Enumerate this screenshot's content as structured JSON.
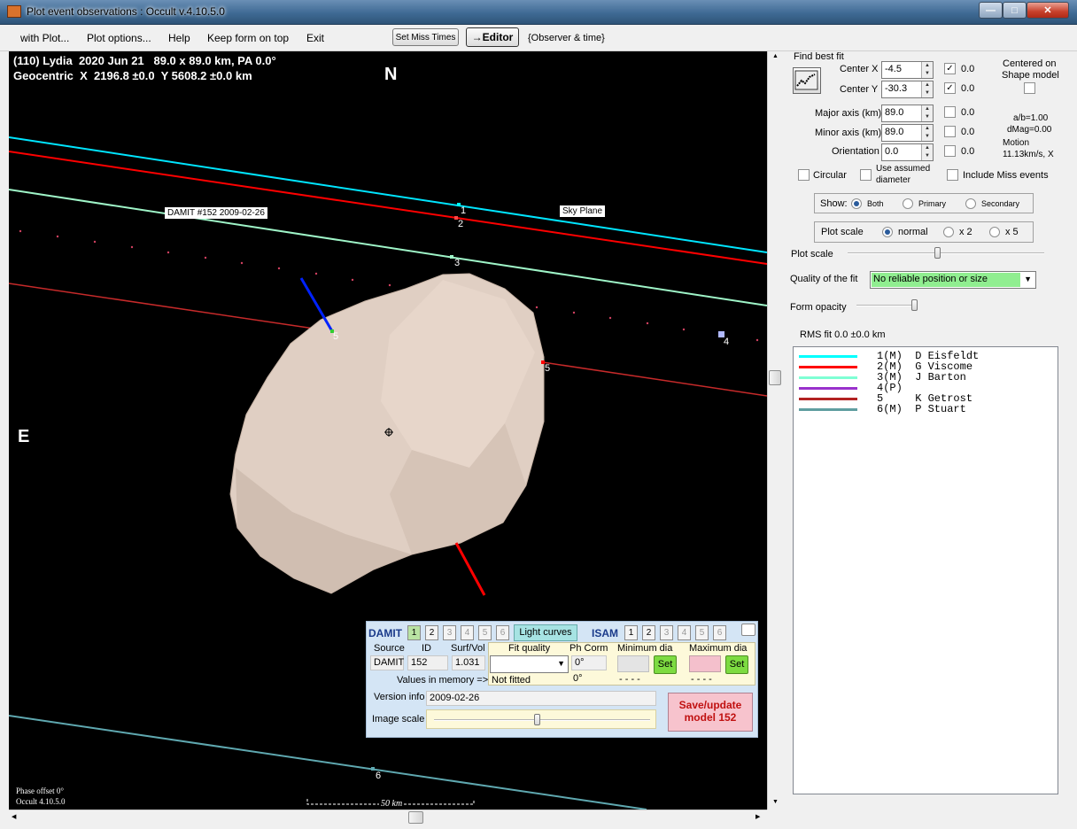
{
  "window": {
    "title": "Plot event observations : Occult v.4.10.5.0",
    "min_glyph": "—",
    "max_glyph": "□",
    "close_glyph": "✕"
  },
  "menu": {
    "items": [
      "with Plot...",
      "Plot options...",
      "Help",
      "Keep form on top",
      "Exit"
    ],
    "set_miss_times": "Set Miss Times",
    "editor": "→Editor",
    "observer_time": "{Observer & time}"
  },
  "plot": {
    "header_line1": "(110) Lydia  2020 Jun 21   89.0 x 89.0 km, PA 0.0°",
    "header_line2": "Geocentric  X  2196.8 ±0.0  Y 5608.2 ±0.0 km",
    "north": "N",
    "east": "E",
    "damit_label": "DAMIT #152 2009-02-26",
    "sky_plane_label": "Sky Plane",
    "chord_labels": [
      "1",
      "2",
      "3",
      "4",
      "5",
      "5",
      "6"
    ],
    "phase_offset": "Phase offset 0°",
    "version": "Occult 4.10.5.0",
    "scale_bar": "50 km"
  },
  "panel": {
    "find_best_fit": "Find best fit",
    "center_x_label": "Center X",
    "center_x_value": "-4.5",
    "center_y_label": "Center Y",
    "center_y_value": "-30.3",
    "center_x_fixed_value": "0.0",
    "center_y_fixed_value": "0.0",
    "centered_on": "Centered on",
    "shape_model": "Shape model",
    "major_axis_label": "Major axis (km)",
    "major_axis_value": "89.0",
    "major_axis_fixed": "0.0",
    "minor_axis_label": "Minor axis (km)",
    "minor_axis_value": "89.0",
    "minor_axis_fixed": "0.0",
    "orientation_label": "Orientation",
    "orientation_value": "0.0",
    "orientation_fixed": "0.0",
    "ab_ratio": "a/b=1.00",
    "dmag": "dMag=0.00",
    "motion_label": "Motion",
    "motion_value": "11.13km/s, X",
    "circular": "Circular",
    "use_assumed": "Use assumed",
    "diameter": "diameter",
    "include_miss": "Include Miss events",
    "show_label": "Show:",
    "show_options": [
      "Both",
      "Primary",
      "Secondary"
    ],
    "plot_scale_group": "Plot scale",
    "scale_options": [
      "normal",
      "x 2",
      "x 5"
    ],
    "plot_scale_slider_label": "Plot scale",
    "plot_scale_slider_level": 0.46,
    "quality_label": "Quality of the fit",
    "quality_value": "No reliable position or size",
    "form_opacity_label": "Form opacity",
    "form_opacity_level": 1.0,
    "rms_fit": "RMS fit 0.0 ±0.0 km",
    "observers": [
      {
        "text": "1(M)  D Eisfeldt",
        "color": "#00ffff"
      },
      {
        "text": "2(M)  G Viscome",
        "color": "#ff0000"
      },
      {
        "text": "3(M)  J Barton",
        "color": "#7fffd4"
      },
      {
        "text": "4(P)",
        "color": "#9932cc"
      },
      {
        "text": "5     K Getrost",
        "color": "#b22222"
      },
      {
        "text": "6(M)  P Stuart",
        "color": "#5f9ea0"
      }
    ]
  },
  "damit": {
    "title": "DAMIT",
    "tabs": [
      "1",
      "2",
      "3",
      "4",
      "5",
      "6"
    ],
    "light_curves": "Light curves",
    "isam": "ISAM",
    "source_header": "Source",
    "id_header": "ID",
    "surf_vol_header": "Surf/Vol",
    "source": "DAMIT",
    "id": "152",
    "surf_vol": "1.031",
    "fit_quality_header": "Fit quality",
    "ph_corr_header": "Ph Corm",
    "min_dia_header": "Minimum dia",
    "max_dia_header": "Maximum dia",
    "ph_corr_value": "0°",
    "ph_corr_value2": "0°",
    "values_in_memory": "Values in memory =>",
    "not_fitted": "Not fitted",
    "min_dashes": "- - - -",
    "max_dashes": "- - - -",
    "set": "Set",
    "version_info_label": "Version info",
    "version_info_value": "2009-02-26",
    "image_scale_label": "Image scale",
    "image_scale_level": 0.48,
    "save_update": "Save/update model 152"
  }
}
